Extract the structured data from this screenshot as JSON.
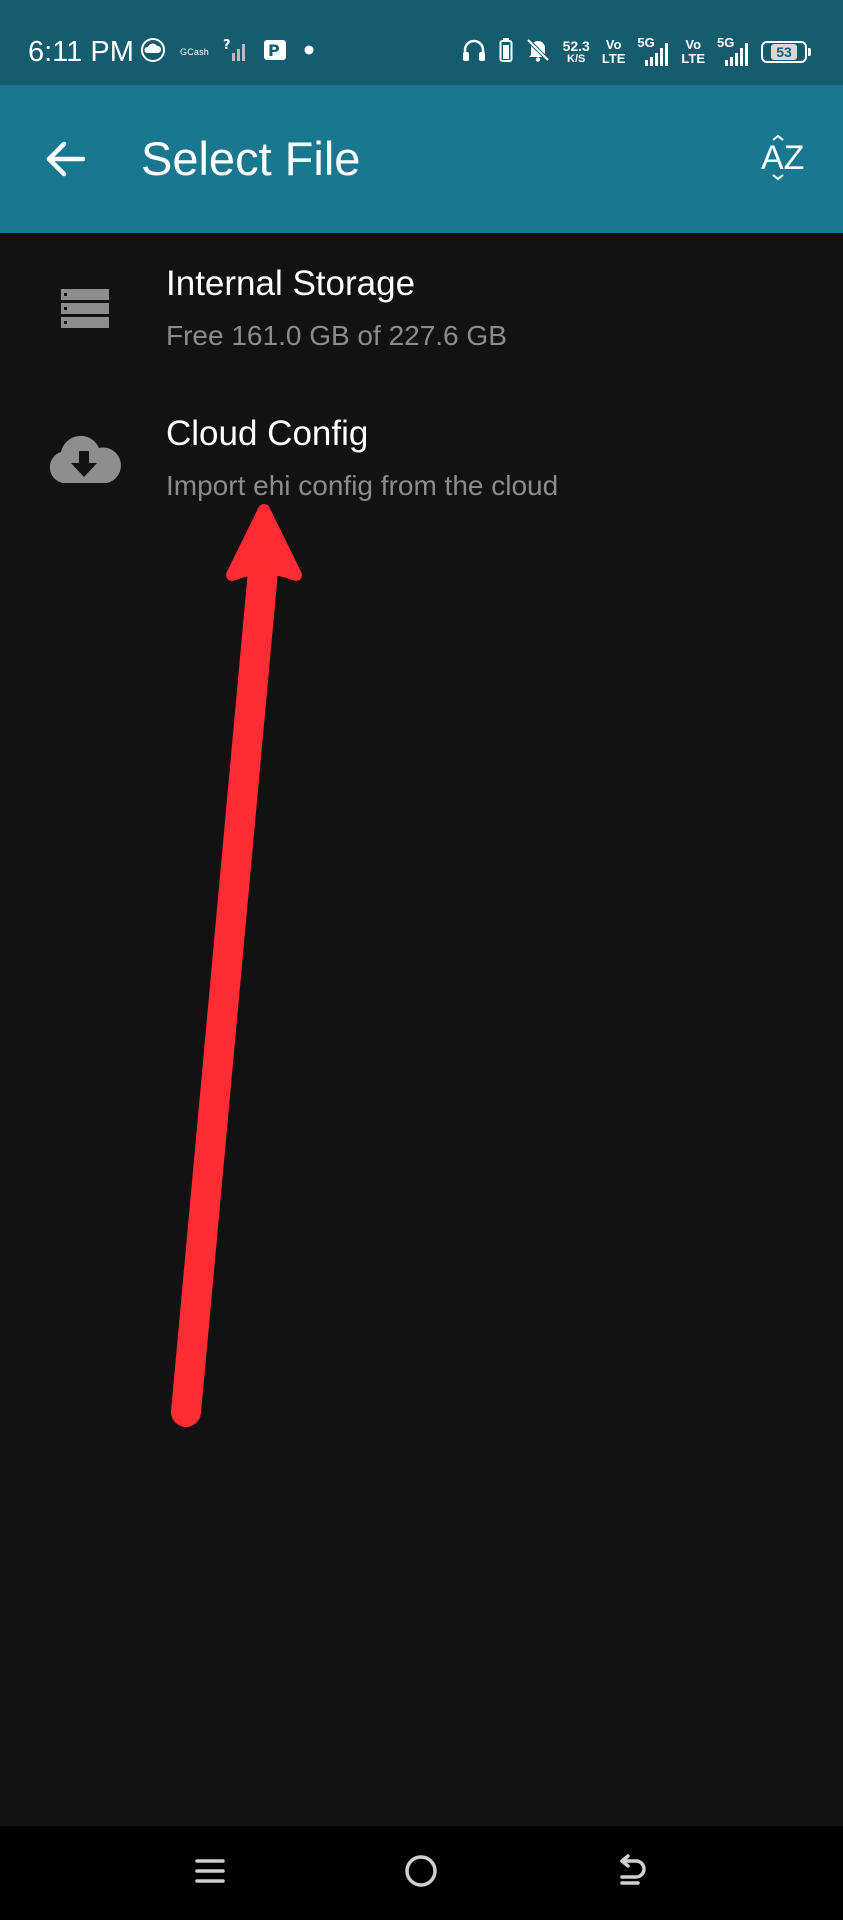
{
  "status_bar": {
    "time": "6:11 PM",
    "gcash_label": "GCash",
    "net_speed_value": "52.3",
    "net_speed_unit": "K/S",
    "volte1_top": "Vo",
    "volte1_bottom": "LTE",
    "sim1_network": "5G",
    "volte2_top": "Vo",
    "volte2_bottom": "LTE",
    "sim2_network": "5G",
    "battery_level": "53",
    "icons": [
      "cloud-icon",
      "signal-no-service-icon",
      "parking-icon",
      "dot-icon",
      "headphones-icon",
      "battery-saver-icon",
      "bell-muted-icon",
      "signal-icon"
    ]
  },
  "app_bar": {
    "title": "Select File",
    "back_icon": "arrow-left-icon",
    "sort_icon": "sort-az-icon",
    "sort_label": "AZ"
  },
  "items": [
    {
      "title": "Internal Storage",
      "subtitle": "Free 161.0 GB of 227.6 GB",
      "icon": "storage-icon"
    },
    {
      "title": "Cloud Config",
      "subtitle": "Import ehi config from the cloud",
      "icon": "cloud-download-icon"
    }
  ],
  "nav_bar": {
    "icons": [
      "menu-icon",
      "home-icon",
      "back-icon"
    ]
  },
  "colors": {
    "status_bar_bg": "#155c6f",
    "app_bar_bg": "#19778f",
    "background": "#121212",
    "subtitle_text": "#8c8c8c",
    "annotation_arrow": "#ff2d33"
  }
}
